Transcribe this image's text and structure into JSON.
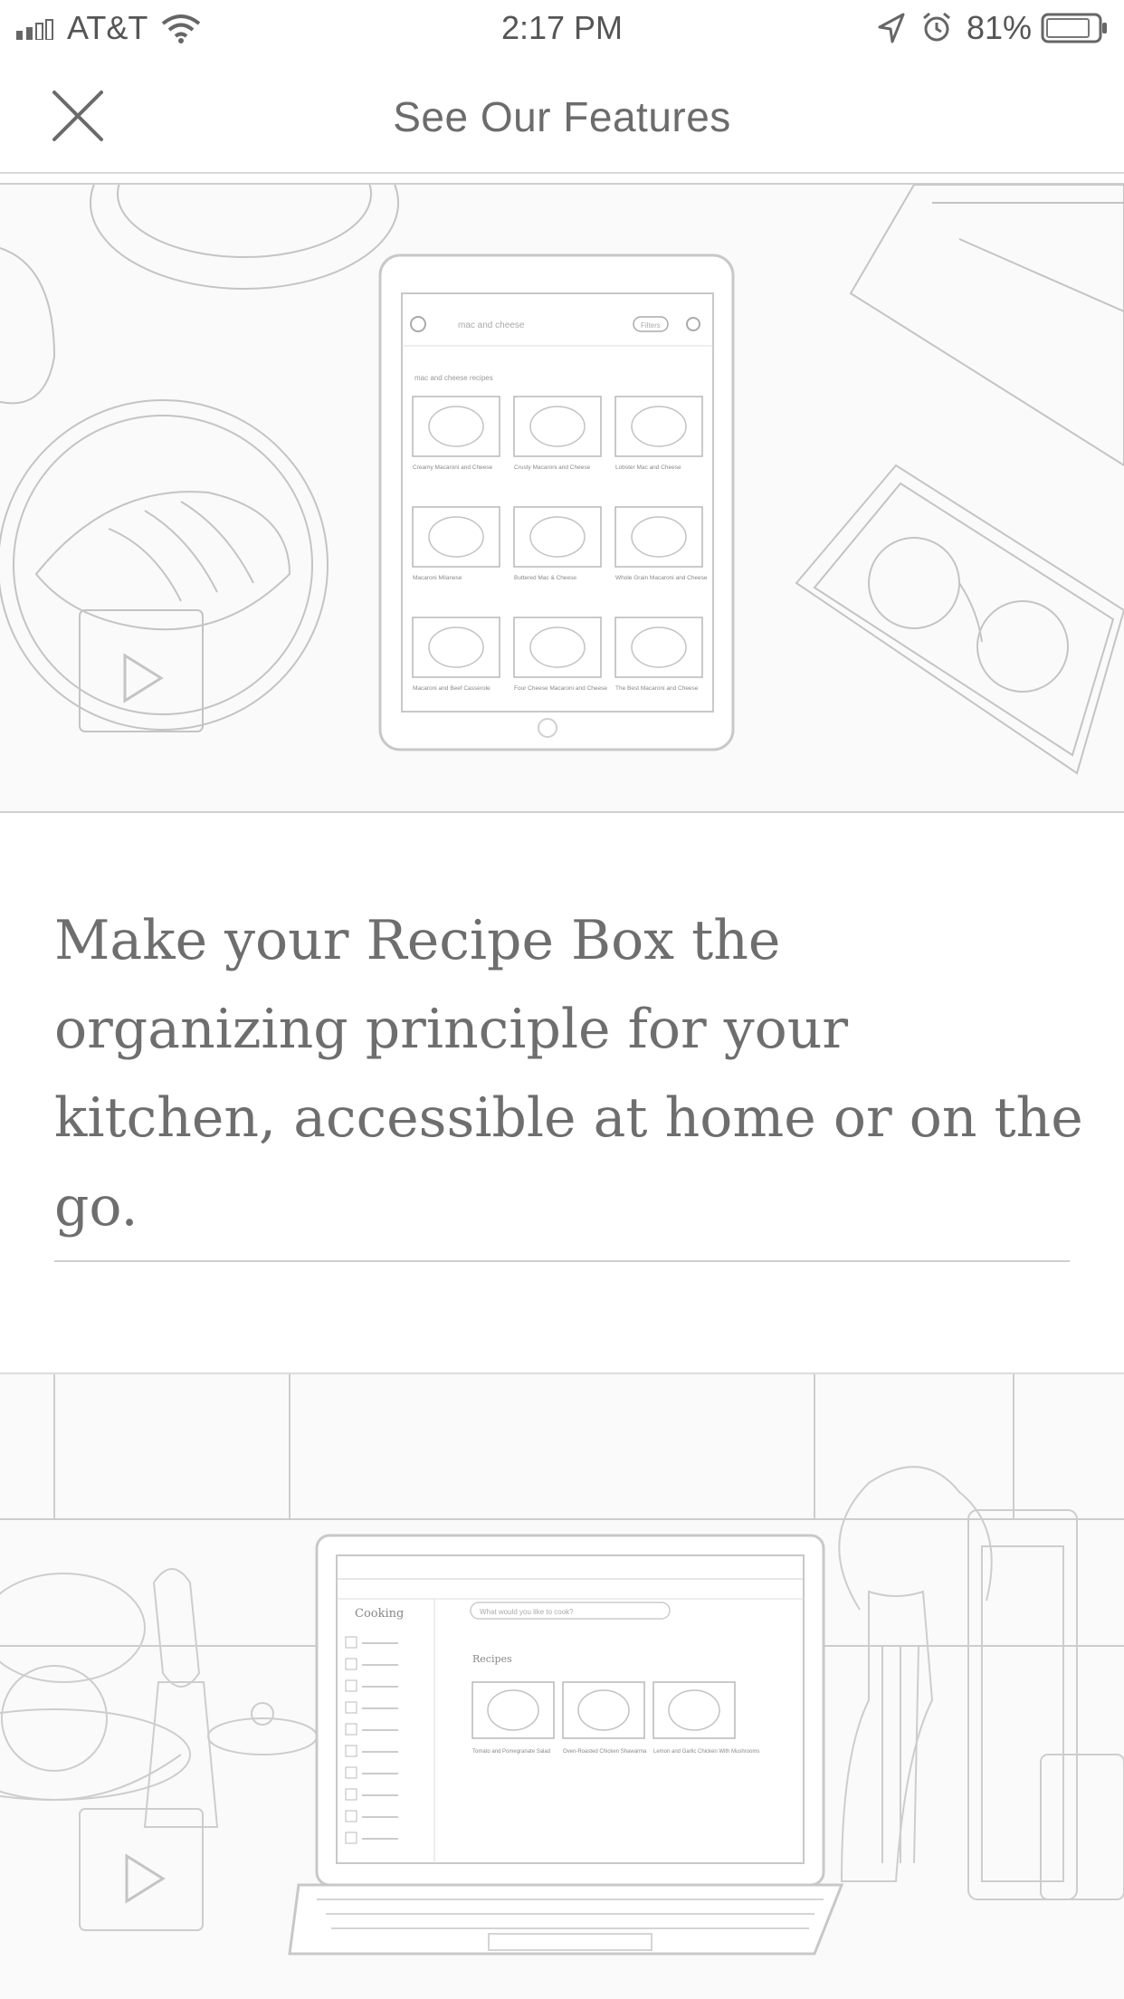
{
  "status_bar": {
    "carrier": "AT&T",
    "time": "2:17 PM",
    "battery_percent": "81%",
    "icons": [
      "signal-icon",
      "wifi-icon",
      "location-arrow-icon",
      "alarm-icon",
      "battery-icon"
    ]
  },
  "nav": {
    "title": "See Our Features",
    "close_icon": "close-icon"
  },
  "feature": {
    "description": "Make your Recipe Box the organizing principle for your kitchen, accessible at home or on the go."
  },
  "tablet_screenshot": {
    "search_text": "mac and cheese",
    "filter_label": "Filters",
    "results_label": "mac and cheese recipes",
    "cards": [
      "Creamy Macaroni and Cheese",
      "Crusty Macaroni and Cheese",
      "Lobster Mac and Cheese",
      "Macaroni Milanese",
      "Buttered Mac & Cheese",
      "Whole Grain Macaroni and Cheese",
      "Macaroni and Beef Casserole",
      "Four Cheese Macaroni and Cheese",
      "The Best Macaroni and Cheese"
    ]
  },
  "laptop_screenshot": {
    "brand": "Cooking",
    "search_placeholder": "What would you like to cook?",
    "section_title": "Recipes",
    "cards": [
      "Tomato and Pomegranate Salad",
      "Oven-Roasted Chicken Shawarma",
      "Lemon and Garlic Chicken With Mushrooms"
    ]
  },
  "colors": {
    "background": "#ffffff",
    "text": "#6e6e6e",
    "line_art": "#bdbdbd"
  }
}
